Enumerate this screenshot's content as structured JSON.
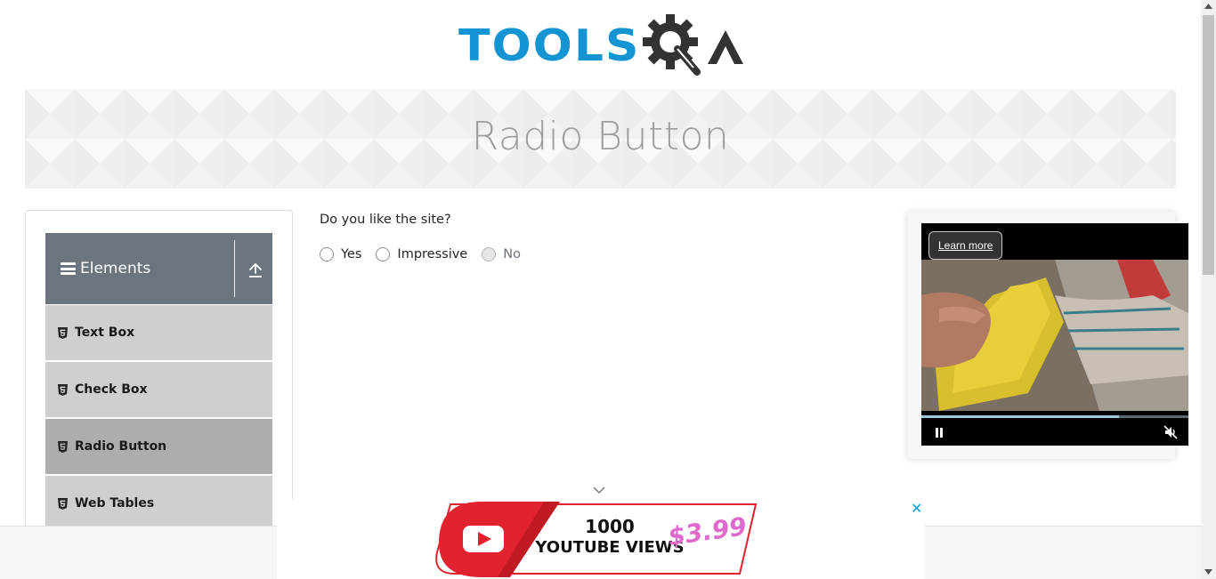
{
  "header": {
    "logo_text": "TOOLS",
    "logo_brand": "TOOLSQA"
  },
  "banner": {
    "title": "Radio Button"
  },
  "sidebar": {
    "group_label": "Elements",
    "items": [
      {
        "label": "Text Box",
        "active": false
      },
      {
        "label": "Check Box",
        "active": false
      },
      {
        "label": "Radio Button",
        "active": true
      },
      {
        "label": "Web Tables",
        "active": false
      }
    ]
  },
  "main": {
    "question": "Do you like the site?",
    "options": [
      {
        "label": "Yes",
        "disabled": false
      },
      {
        "label": "Impressive",
        "disabled": false
      },
      {
        "label": "No",
        "disabled": true
      }
    ]
  },
  "video_ad": {
    "learn_more": "Learn more",
    "progress_fraction": 0.74
  },
  "bottom_ad": {
    "views_count": "1000",
    "views_label": "YOUTUBE VIEWS",
    "price": "$3.99",
    "close_symbol": "✕"
  },
  "colors": {
    "brand_blue": "#1594d3",
    "brand_dark": "#333333",
    "sidebar_header": "#6c757d",
    "menu_item": "#cfcfcf",
    "menu_item_active": "#adadad",
    "ad_red": "#e1232f",
    "ad_price": "#e06acb",
    "close_blue": "#00a3d8"
  },
  "icons": {
    "sidebar_group": "hamburger-icon",
    "collapse": "upload-arrow-icon",
    "menu_item": "html5-icon",
    "video_pause": "pause-icon",
    "video_mute": "muted-speaker-icon",
    "ad_toggle": "chevron-down-icon"
  }
}
